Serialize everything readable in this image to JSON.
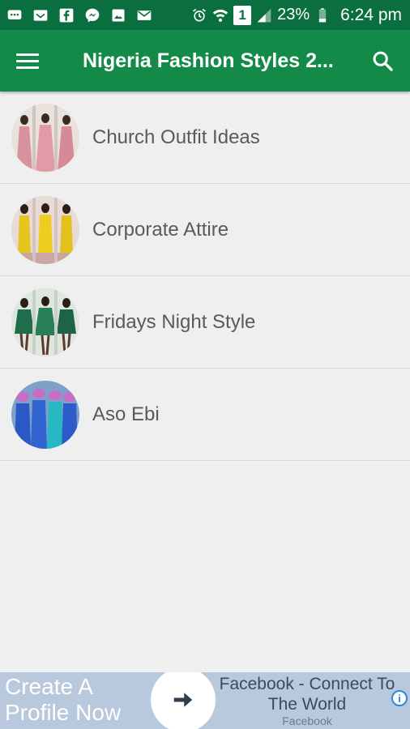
{
  "status_bar": {
    "icons": [
      "chat-icon",
      "mail-icon",
      "facebook-icon",
      "messenger-icon",
      "image-icon",
      "email-icon"
    ],
    "battery": "23%",
    "time": "6:24 pm",
    "sim_number": "1"
  },
  "app_bar": {
    "title": "Nigeria Fashion Styles 2...",
    "menu_icon": "hamburger-menu-icon",
    "search_icon": "search-icon",
    "color": "#138a47"
  },
  "list": {
    "items": [
      {
        "label": "Church Outfit Ideas"
      },
      {
        "label": "Corporate Attire"
      },
      {
        "label": "Fridays Night Style"
      },
      {
        "label": "Aso Ebi"
      }
    ]
  },
  "ad": {
    "headline_line1": "Create A",
    "headline_line2": "Profile Now",
    "title_line1": "Facebook - Connect To",
    "title_line2": "The World",
    "sponsor": "Facebook",
    "info_icon": "info-icon"
  }
}
